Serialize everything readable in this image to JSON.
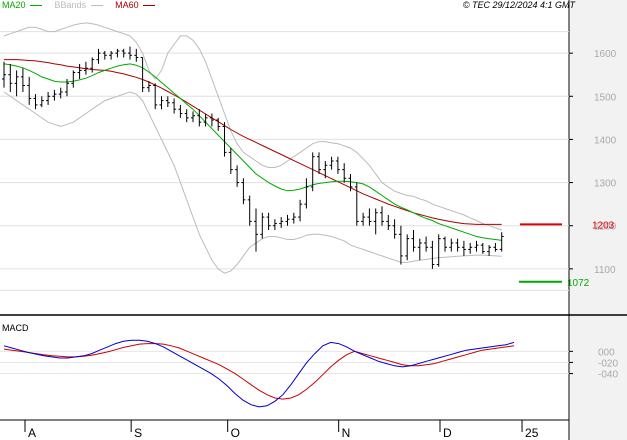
{
  "header": {
    "legend": [
      {
        "label": "MA20",
        "color": "#00aa00"
      },
      {
        "label": "BBands",
        "color": "#bbbbbb"
      },
      {
        "label": "MA60",
        "color": "#aa0000"
      }
    ],
    "copyright": "© TEC 29/12/2024 4:1 GMT"
  },
  "macd_title": "MACD",
  "chart_data": [
    {
      "type": "candlestick",
      "title": "",
      "ylim": [
        1000,
        1700
      ],
      "y_ticks": [
        1100,
        1200,
        1300,
        1400,
        1500,
        1600
      ],
      "y_tick_labels": [
        "1100",
        "1200",
        "1300",
        "1400",
        "1500",
        "1600"
      ],
      "x_ticks": [
        {
          "index": 0,
          "label": "A"
        },
        {
          "index": 22,
          "label": "S"
        },
        {
          "index": 42,
          "label": "O"
        },
        {
          "index": 65,
          "label": "N"
        },
        {
          "index": 86,
          "label": "D"
        },
        {
          "index": 103,
          "label": "25"
        }
      ],
      "price_tags": [
        {
          "label": "1203",
          "value": 1203,
          "color": "#dd0000",
          "series": "MA60"
        },
        {
          "label": "1072",
          "value": 1070,
          "color": "#00aa00",
          "series": "MA20"
        }
      ],
      "ohlc": [
        [
          1540,
          1580,
          1520,
          1550
        ],
        [
          1550,
          1575,
          1510,
          1530
        ],
        [
          1530,
          1560,
          1500,
          1545
        ],
        [
          1545,
          1565,
          1510,
          1525
        ],
        [
          1525,
          1545,
          1480,
          1495
        ],
        [
          1495,
          1505,
          1470,
          1480
        ],
        [
          1480,
          1500,
          1475,
          1490
        ],
        [
          1490,
          1510,
          1480,
          1500
        ],
        [
          1500,
          1515,
          1490,
          1505
        ],
        [
          1505,
          1520,
          1495,
          1510
        ],
        [
          1510,
          1540,
          1500,
          1530
        ],
        [
          1530,
          1560,
          1520,
          1555
        ],
        [
          1555,
          1575,
          1540,
          1560
        ],
        [
          1560,
          1580,
          1550,
          1565
        ],
        [
          1565,
          1590,
          1555,
          1585
        ],
        [
          1585,
          1610,
          1575,
          1600
        ],
        [
          1600,
          1605,
          1585,
          1595
        ],
        [
          1595,
          1605,
          1585,
          1600
        ],
        [
          1600,
          1610,
          1590,
          1605
        ],
        [
          1605,
          1610,
          1590,
          1600
        ],
        [
          1600,
          1615,
          1585,
          1595
        ],
        [
          1595,
          1610,
          1580,
          1590
        ],
        [
          1590,
          1590,
          1510,
          1520
        ],
        [
          1520,
          1535,
          1510,
          1525
        ],
        [
          1525,
          1530,
          1470,
          1480
        ],
        [
          1480,
          1500,
          1470,
          1490
        ],
        [
          1490,
          1500,
          1475,
          1485
        ],
        [
          1485,
          1495,
          1460,
          1470
        ],
        [
          1470,
          1480,
          1450,
          1460
        ],
        [
          1460,
          1470,
          1440,
          1450
        ],
        [
          1450,
          1465,
          1440,
          1455
        ],
        [
          1455,
          1470,
          1430,
          1440
        ],
        [
          1440,
          1460,
          1430,
          1450
        ],
        [
          1450,
          1460,
          1430,
          1445
        ],
        [
          1445,
          1450,
          1420,
          1430
        ],
        [
          1430,
          1440,
          1360,
          1370
        ],
        [
          1370,
          1380,
          1320,
          1330
        ],
        [
          1330,
          1340,
          1290,
          1300
        ],
        [
          1300,
          1310,
          1250,
          1260
        ],
        [
          1260,
          1270,
          1200,
          1210
        ],
        [
          1210,
          1240,
          1140,
          1180
        ],
        [
          1180,
          1230,
          1170,
          1220
        ],
        [
          1220,
          1230,
          1190,
          1200
        ],
        [
          1200,
          1215,
          1190,
          1205
        ],
        [
          1205,
          1220,
          1195,
          1210
        ],
        [
          1210,
          1225,
          1200,
          1215
        ],
        [
          1215,
          1230,
          1205,
          1220
        ],
        [
          1220,
          1260,
          1210,
          1250
        ],
        [
          1250,
          1310,
          1240,
          1290
        ],
        [
          1290,
          1370,
          1280,
          1360
        ],
        [
          1360,
          1370,
          1320,
          1330
        ],
        [
          1330,
          1350,
          1310,
          1340
        ],
        [
          1340,
          1360,
          1330,
          1350
        ],
        [
          1350,
          1360,
          1320,
          1330
        ],
        [
          1330,
          1345,
          1300,
          1310
        ],
        [
          1310,
          1320,
          1280,
          1290
        ],
        [
          1290,
          1300,
          1200,
          1210
        ],
        [
          1210,
          1230,
          1200,
          1220
        ],
        [
          1220,
          1240,
          1200,
          1210
        ],
        [
          1210,
          1240,
          1180,
          1230
        ],
        [
          1230,
          1245,
          1200,
          1210
        ],
        [
          1210,
          1225,
          1190,
          1200
        ],
        [
          1200,
          1215,
          1170,
          1180
        ],
        [
          1180,
          1200,
          1110,
          1130
        ],
        [
          1130,
          1180,
          1120,
          1170
        ],
        [
          1170,
          1190,
          1140,
          1150
        ],
        [
          1150,
          1170,
          1120,
          1160
        ],
        [
          1160,
          1175,
          1140,
          1150
        ],
        [
          1150,
          1165,
          1100,
          1110
        ],
        [
          1110,
          1180,
          1105,
          1170
        ],
        [
          1170,
          1175,
          1140,
          1150
        ],
        [
          1150,
          1170,
          1140,
          1160
        ],
        [
          1160,
          1170,
          1140,
          1150
        ],
        [
          1150,
          1165,
          1130,
          1145
        ],
        [
          1145,
          1160,
          1135,
          1150
        ],
        [
          1150,
          1165,
          1140,
          1155
        ],
        [
          1155,
          1160,
          1135,
          1140
        ],
        [
          1140,
          1155,
          1130,
          1150
        ],
        [
          1150,
          1160,
          1140,
          1145
        ],
        [
          1145,
          1185,
          1140,
          1175
        ]
      ],
      "series": [
        {
          "name": "MA20",
          "color": "#00aa00",
          "values": [
            1575,
            1573,
            1570,
            1566,
            1560,
            1553,
            1545,
            1540,
            1535,
            1533,
            1533,
            1535,
            1538,
            1542,
            1548,
            1555,
            1560,
            1565,
            1570,
            1573,
            1575,
            1572,
            1566,
            1556,
            1545,
            1532,
            1520,
            1507,
            1495,
            1482,
            1470,
            1455,
            1440,
            1425,
            1410,
            1395,
            1380,
            1365,
            1350,
            1335,
            1320,
            1310,
            1300,
            1292,
            1285,
            1281,
            1282,
            1285,
            1290,
            1295,
            1298,
            1300,
            1302,
            1303,
            1303,
            1302,
            1300,
            1297,
            1290,
            1280,
            1270,
            1260,
            1250,
            1243,
            1237,
            1230,
            1223,
            1217,
            1212,
            1205,
            1200,
            1195,
            1190,
            1185,
            1180,
            1175,
            1172,
            1170,
            1168,
            1166
          ]
        },
        {
          "name": "BBands",
          "color": "#bbbbbb",
          "upper": [
            1640,
            1645,
            1650,
            1655,
            1660,
            1660,
            1655,
            1650,
            1650,
            1655,
            1660,
            1665,
            1668,
            1670,
            1668,
            1665,
            1660,
            1655,
            1650,
            1645,
            1640,
            1625,
            1600,
            1560,
            1540,
            1560,
            1600,
            1620,
            1640,
            1640,
            1630,
            1610,
            1580,
            1540,
            1500,
            1460,
            1420,
            1390,
            1370,
            1360,
            1350,
            1340,
            1335,
            1335,
            1340,
            1350,
            1360,
            1370,
            1380,
            1390,
            1395,
            1395,
            1392,
            1390,
            1385,
            1380,
            1370,
            1355,
            1340,
            1320,
            1300,
            1290,
            1280,
            1275,
            1270,
            1268,
            1262,
            1258,
            1250,
            1245,
            1240,
            1235,
            1230,
            1225,
            1218,
            1212,
            1205,
            1200,
            1195,
            1190
          ],
          "lower": [
            1510,
            1500,
            1490,
            1480,
            1470,
            1460,
            1450,
            1440,
            1435,
            1430,
            1435,
            1440,
            1450,
            1460,
            1470,
            1480,
            1490,
            1495,
            1500,
            1505,
            1510,
            1505,
            1490,
            1460,
            1430,
            1400,
            1370,
            1340,
            1300,
            1260,
            1220,
            1180,
            1150,
            1120,
            1100,
            1090,
            1095,
            1110,
            1130,
            1150,
            1160,
            1170,
            1175,
            1175,
            1172,
            1168,
            1168,
            1172,
            1178,
            1180,
            1180,
            1178,
            1175,
            1170,
            1165,
            1155,
            1150,
            1145,
            1140,
            1135,
            1130,
            1125,
            1120,
            1115,
            1115,
            1118,
            1120,
            1122,
            1124,
            1126,
            1127,
            1128,
            1129,
            1130,
            1131,
            1132,
            1132,
            1131,
            1130,
            1129
          ]
        },
        {
          "name": "MA60",
          "color": "#aa0000",
          "values": [
            1585,
            1585,
            1585,
            1584,
            1583,
            1582,
            1580,
            1578,
            1575,
            1573,
            1570,
            1568,
            1566,
            1564,
            1562,
            1561,
            1560,
            1558,
            1555,
            1552,
            1548,
            1544,
            1539,
            1533,
            1526,
            1519,
            1511,
            1503,
            1495,
            1486,
            1477,
            1468,
            1459,
            1450,
            1441,
            1432,
            1423,
            1415,
            1407,
            1400,
            1393,
            1386,
            1379,
            1372,
            1365,
            1358,
            1351,
            1344,
            1337,
            1330,
            1323,
            1316,
            1309,
            1302,
            1295,
            1288,
            1281,
            1274,
            1268,
            1262,
            1256,
            1250,
            1245,
            1240,
            1235,
            1230,
            1226,
            1222,
            1218,
            1215,
            1212,
            1209,
            1207,
            1205,
            1204,
            1203,
            1203,
            1203,
            1203,
            1203
          ]
        }
      ]
    },
    {
      "type": "line",
      "title": "MACD",
      "ylim": [
        -120,
        60
      ],
      "y_ticks": [
        0,
        -20,
        -40
      ],
      "y_tick_labels": [
        "000",
        "-020",
        "-040"
      ],
      "series": [
        {
          "name": "MACD",
          "color": "#0000cc",
          "values": [
            10,
            6,
            2,
            -2,
            -5,
            -8,
            -10,
            -12,
            -12,
            -10,
            -8,
            -4,
            2,
            8,
            14,
            18,
            20,
            20,
            18,
            14,
            8,
            0,
            -8,
            -16,
            -24,
            -32,
            -40,
            -50,
            -62,
            -76,
            -88,
            -96,
            -100,
            -98,
            -90,
            -78,
            -60,
            -40,
            -20,
            -4,
            10,
            16,
            14,
            8,
            0,
            -6,
            -12,
            -18,
            -22,
            -26,
            -28,
            -26,
            -22,
            -18,
            -14,
            -10,
            -6,
            -2,
            2,
            4,
            6,
            8,
            10,
            12,
            16
          ]
        },
        {
          "name": "Signal",
          "color": "#cc0000",
          "values": [
            4,
            2,
            0,
            -2,
            -4,
            -6,
            -8,
            -9,
            -10,
            -10,
            -9,
            -7,
            -4,
            -1,
            3,
            7,
            10,
            13,
            14,
            14,
            13,
            10,
            6,
            0,
            -6,
            -12,
            -18,
            -24,
            -32,
            -40,
            -50,
            -60,
            -70,
            -78,
            -84,
            -86,
            -84,
            -78,
            -68,
            -56,
            -42,
            -28,
            -16,
            -6,
            0,
            -4,
            -8,
            -12,
            -16,
            -20,
            -24,
            -26,
            -26,
            -24,
            -22,
            -18,
            -14,
            -10,
            -6,
            -2,
            2,
            4,
            6,
            8,
            10
          ]
        }
      ]
    }
  ]
}
